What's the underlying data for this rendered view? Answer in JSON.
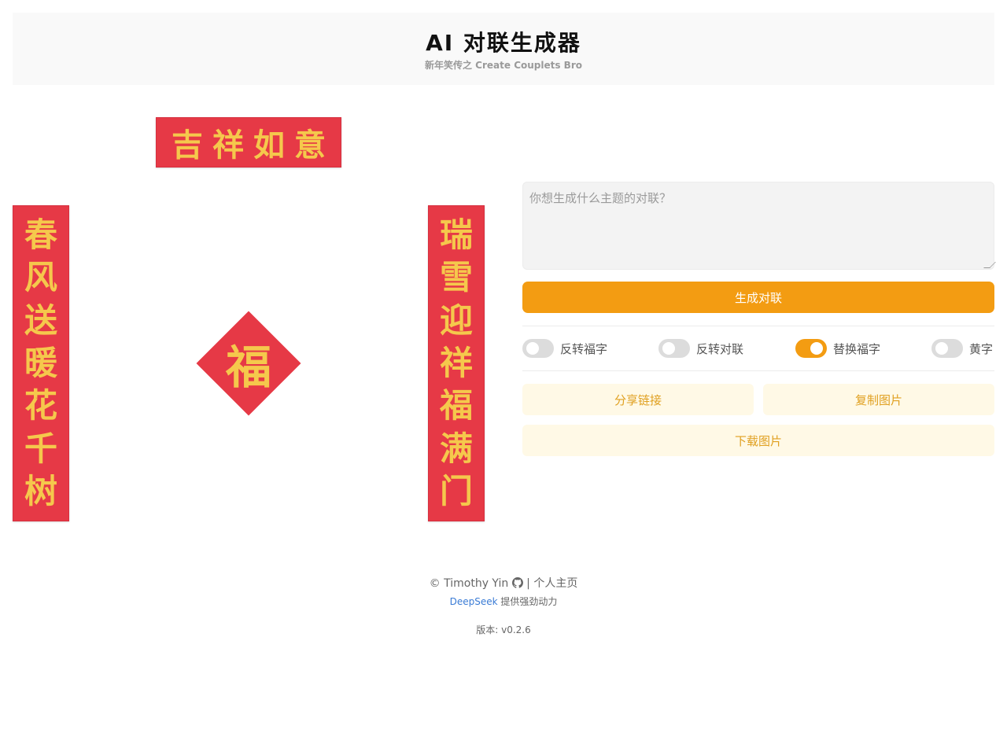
{
  "header": {
    "title": "AI 对联生成器",
    "subtitle": "新年笑传之 Create Couplets Bro"
  },
  "couplet": {
    "horizontal": "吉祥如意",
    "left": [
      "春",
      "风",
      "送",
      "暖",
      "花",
      "千",
      "树"
    ],
    "right": [
      "瑞",
      "雪",
      "迎",
      "祥",
      "福",
      "满",
      "门"
    ],
    "fu": "福"
  },
  "form": {
    "prompt_placeholder": "你想生成什么主题的对联？",
    "prompt_value": "",
    "generate_label": "生成对联"
  },
  "toggles": [
    {
      "label": "反转福字",
      "on": false
    },
    {
      "label": "反转对联",
      "on": false
    },
    {
      "label": "替换福字",
      "on": true
    },
    {
      "label": "黄字",
      "on": false
    }
  ],
  "actions": {
    "share_label": "分享链接",
    "copy_label": "复制图片",
    "download_label": "下载图片"
  },
  "footer": {
    "copyright": "© Timothy Yin",
    "separator": "|",
    "homepage": "个人主页",
    "powered_link": "DeepSeek",
    "powered_text": "提供强劲动力",
    "version": "版本: v0.2.6"
  },
  "colors": {
    "accent": "#f39c12",
    "couplet_red": "#e63946",
    "couplet_gold": "#f5c84c",
    "action_bg": "#fff9e6",
    "action_text": "#e0a020",
    "link": "#3a7bd5"
  },
  "icons": {
    "github": "github-icon"
  }
}
